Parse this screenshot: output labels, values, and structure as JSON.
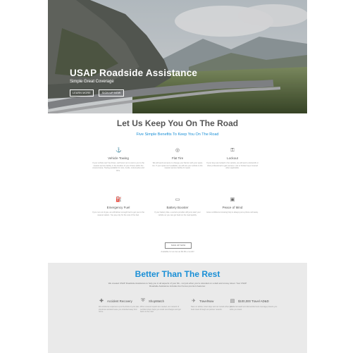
{
  "hero": {
    "title": "USAP Roadside Assistance",
    "subtitle": "Simple Great Coverage",
    "buttons": [
      {
        "label": "LEARN MORE"
      },
      {
        "label": "SIGN UP NOW"
      }
    ]
  },
  "benefits_section": {
    "title": "Let Us Keep You On The Road",
    "subtitle": "Five Simple Benefits To Keep You On The Road",
    "features": [
      {
        "icon": "tow-hook-icon",
        "title": "Vehicle Towing",
        "text": "If your vehicle can't be driven, we'll tow it at no cost to you to the nearest service facility or the location of your choice within the covered area. Towing available for cars, trucks, motorcycles and RVs."
      },
      {
        "icon": "tire-icon",
        "title": "Flat Tire",
        "text": "We will send someone to change your flat tire with your spare tire. If your spare isn't available, we will tow your vehicle to the nearest service facility for repair."
      },
      {
        "icon": "key-icon",
        "title": "Lockout",
        "text": "If your keys are locked in the vehicle, we will send a locksmith or other professional to gain access. Lost or broken keys covered when applicable."
      },
      {
        "icon": "fuel-pump-icon",
        "title": "Emergency Fuel",
        "text": "If you run out of gas, we will deliver enough fuel to get you to the nearest station. You pay only for the cost of the fuel."
      },
      {
        "icon": "battery-icon",
        "title": "Battery Booster",
        "text": "If your battery dies, a service provider will jump start your vehicle so you can get back on the road quickly."
      },
      {
        "icon": "car-icon",
        "title": "Peace of Mind",
        "text": "Have confidence knowing help is always just a phone call away."
      }
    ],
    "signup_label": "SIGN UP NOW",
    "note": "Available for as low as $3.99 a month!"
  },
  "better_section": {
    "title": "Better Than The Rest",
    "description": "We created USAP Roadside Assistance to help you in all aspects of your life - not just when you're stranded on a dark and snowy street. Your USAP Roadside Assistance includes four bonus premium features:",
    "benefits": [
      {
        "icon": "medkit-icon",
        "title": "Accident Recovery",
        "text": "We reimburse expenses up to the limits of your plan should an accident leave you stranded away from home."
      },
      {
        "icon": "shield-icon",
        "title": "ShopWatch",
        "text": "When covered repairs are needed, our network of certified shops helps you avoid overcharges and get back on the road."
      },
      {
        "icon": "plane-icon",
        "title": "TravelNow",
        "text": "Save on airfare, hotel stays and car rentals when you book travel through our partner network."
      },
      {
        "icon": "coverage-icon",
        "title": "$100,000 Travel AD&D",
        "text": "Accidental death and dismemberment coverage protects you while you travel."
      }
    ]
  }
}
